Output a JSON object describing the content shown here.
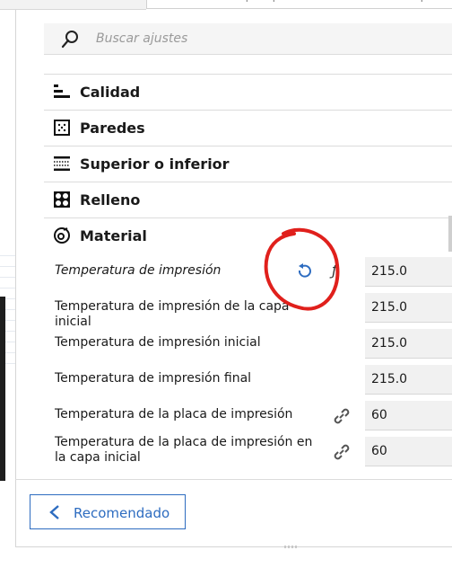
{
  "search": {
    "placeholder": "Buscar ajustes"
  },
  "categories": [
    {
      "label": "Calidad",
      "icon": "quality-icon"
    },
    {
      "label": "Paredes",
      "icon": "walls-icon"
    },
    {
      "label": "Superior o inferior",
      "icon": "top-bottom-icon"
    },
    {
      "label": "Relleno",
      "icon": "infill-icon"
    },
    {
      "label": "Material",
      "icon": "material-icon"
    }
  ],
  "settings": [
    {
      "label": "Temperatura de impresión",
      "value": "215.0"
    },
    {
      "label": "Temperatura de impresión de la capa inicial",
      "value": "215.0"
    },
    {
      "label": "Temperatura de impresión inicial",
      "value": "215.0"
    },
    {
      "label": "Temperatura de impresión final",
      "value": "215.0"
    },
    {
      "label": "Temperatura de la placa de impresión",
      "value": "60"
    },
    {
      "label": "Temperatura de la placa de impresión en la capa inicial",
      "value": "60"
    }
  ],
  "footer": {
    "recommended_label": "Recomendado"
  },
  "colors": {
    "accent": "#2d6cc0",
    "annotation": "#e0201c"
  }
}
